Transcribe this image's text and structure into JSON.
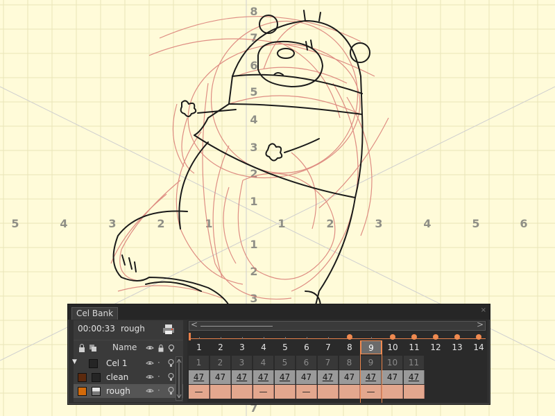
{
  "grid_labels": {
    "horizontal": [
      "5",
      "4",
      "3",
      "2",
      "1",
      "1",
      "2",
      "3",
      "4",
      "5",
      "6"
    ],
    "vertical": [
      "8",
      "7",
      "6",
      "5",
      "4",
      "3",
      "2",
      "1",
      "1",
      "2",
      "3",
      "7"
    ]
  },
  "panel": {
    "tab_label": "Cel Bank",
    "close_glyph": "×",
    "timecode": "00:00:33",
    "current_layer": "rough",
    "header_name": "Name",
    "layers": [
      {
        "name": "Cel 1",
        "color": "#2a2a2a",
        "expanded": true
      },
      {
        "name": "clean",
        "color": "#5c2a0e"
      },
      {
        "name": "rough",
        "color": "#d26a0a"
      }
    ],
    "scroll_left": "<",
    "scroll_right": ">"
  },
  "timeline": {
    "frames": [
      "1",
      "2",
      "3",
      "4",
      "5",
      "6",
      "7",
      "8",
      "9",
      "10",
      "11",
      "12",
      "13",
      "14"
    ],
    "current_frame": "9",
    "keyframes": [
      "8",
      "10",
      "11",
      "12",
      "13",
      "14"
    ],
    "cel1_cells": [
      "1",
      "2",
      "3",
      "4",
      "5",
      "6",
      "7",
      "8",
      "9",
      "10",
      "11"
    ],
    "clean_cells": [
      "47",
      "47",
      "47",
      "47",
      "47",
      "47",
      "47",
      "47",
      "47",
      "47",
      "47"
    ],
    "rough_cells": [
      "—",
      "",
      "",
      "—",
      "",
      "—",
      "",
      "",
      "—",
      "",
      ""
    ]
  },
  "colors": {
    "canvas": "#fffbd9",
    "grid": "#e9e4b7",
    "accent": "#f08a50",
    "rough_line": "#d97a74",
    "clean_line": "#1a1a1a"
  }
}
